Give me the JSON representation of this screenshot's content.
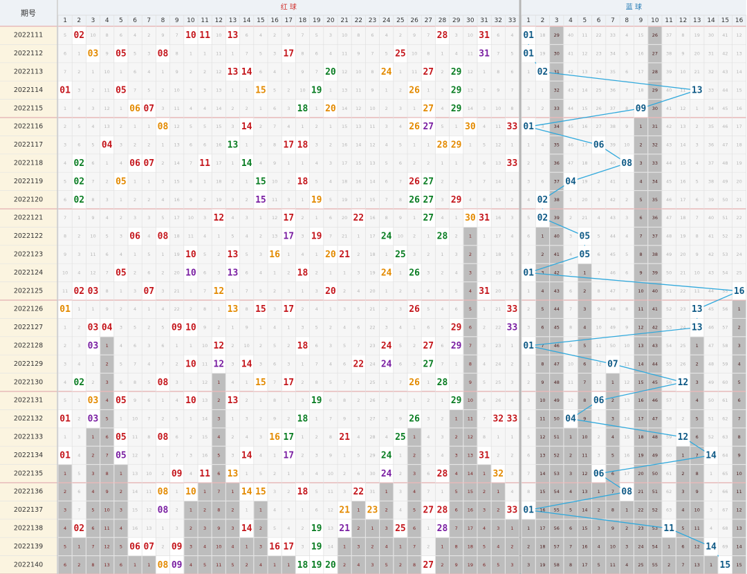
{
  "header": {
    "period_label": "期号",
    "red_section": "红 球",
    "blue_section": "蓝 球",
    "red_numbers": [
      "1",
      "2",
      "3",
      "4",
      "5",
      "6",
      "7",
      "8",
      "9",
      "10",
      "11",
      "12",
      "13",
      "14",
      "15",
      "16",
      "17",
      "18",
      "19",
      "20",
      "21",
      "22",
      "23",
      "24",
      "25",
      "26",
      "27",
      "28",
      "29",
      "30",
      "31",
      "32",
      "33"
    ],
    "blue_numbers": [
      "1",
      "2",
      "3",
      "4",
      "5",
      "6",
      "7",
      "8",
      "9",
      "10",
      "11",
      "12",
      "13",
      "14",
      "15",
      "16"
    ]
  },
  "colors": {
    "red_ball_palette": [
      "#c4161c",
      "#e38a00",
      "#0a7d23",
      "#7a1fa2"
    ],
    "blue_ball": "#0f5a86",
    "trend_line": "#2ea8dc",
    "missing_bar": "#bdbdbd",
    "header_bg": "#eef2f6",
    "period_bg": "#fbf4e0"
  },
  "chart_data": {
    "type": "table",
    "title": "",
    "periods": [
      "2022111",
      "2022112",
      "2022113",
      "2022114",
      "2022115",
      "2022116",
      "2022117",
      "2022118",
      "2022119",
      "2022120",
      "2022121",
      "2022122",
      "2022123",
      "2022124",
      "2022125",
      "2022126",
      "2022127",
      "2022128",
      "2022129",
      "2022130",
      "2022131",
      "2022132",
      "2022133",
      "2022134",
      "2022135",
      "2022136",
      "2022137",
      "2022138",
      "2022139",
      "2022140"
    ],
    "red_balls": [
      [
        2,
        10,
        11,
        13,
        28,
        31
      ],
      [
        3,
        5,
        8,
        17,
        25,
        31
      ],
      [
        13,
        14,
        20,
        24,
        27,
        29
      ],
      [
        1,
        5,
        15,
        19,
        26,
        29
      ],
      [
        6,
        7,
        18,
        20,
        27,
        29
      ],
      [
        8,
        14,
        26,
        27,
        30,
        33
      ],
      [
        4,
        13,
        17,
        18,
        28,
        29
      ],
      [
        2,
        6,
        7,
        11,
        14,
        33
      ],
      [
        2,
        5,
        15,
        18,
        26,
        27
      ],
      [
        2,
        15,
        19,
        26,
        27,
        29
      ],
      [
        12,
        17,
        22,
        27,
        30,
        31
      ],
      [
        6,
        8,
        17,
        19,
        24,
        28
      ],
      [
        10,
        13,
        16,
        20,
        21,
        25
      ],
      [
        5,
        10,
        13,
        18,
        24,
        26
      ],
      [
        2,
        3,
        7,
        12,
        20,
        31
      ],
      [
        1,
        13,
        15,
        17,
        26,
        33
      ],
      [
        3,
        4,
        9,
        10,
        29,
        33
      ],
      [
        3,
        12,
        18,
        24,
        27,
        29
      ],
      [
        10,
        12,
        14,
        22,
        24,
        27
      ],
      [
        2,
        8,
        15,
        17,
        26,
        28
      ],
      [
        3,
        5,
        10,
        13,
        19,
        29
      ],
      [
        1,
        3,
        18,
        26,
        32,
        33
      ],
      [
        5,
        8,
        16,
        17,
        21,
        25
      ],
      [
        1,
        5,
        14,
        17,
        24,
        31
      ],
      [
        9,
        11,
        13,
        24,
        28,
        32
      ],
      [
        8,
        10,
        14,
        15,
        18,
        22
      ],
      [
        8,
        21,
        23,
        27,
        28,
        33
      ],
      [
        2,
        14,
        19,
        21,
        25,
        28
      ],
      [
        6,
        7,
        9,
        16,
        17,
        19
      ],
      [
        8,
        9,
        18,
        19,
        20,
        27
      ]
    ],
    "red_ball_colors": [
      [
        0,
        0,
        0,
        0,
        0,
        0
      ],
      [
        1,
        0,
        0,
        0,
        0,
        3
      ],
      [
        0,
        0,
        2,
        1,
        0,
        2
      ],
      [
        0,
        0,
        1,
        2,
        1,
        2
      ],
      [
        1,
        0,
        2,
        1,
        1,
        2
      ],
      [
        1,
        0,
        1,
        3,
        1,
        0
      ],
      [
        0,
        2,
        0,
        0,
        1,
        1
      ],
      [
        2,
        0,
        0,
        0,
        2,
        0
      ],
      [
        2,
        1,
        2,
        0,
        0,
        2
      ],
      [
        2,
        3,
        1,
        2,
        2,
        0
      ],
      [
        0,
        0,
        0,
        2,
        1,
        0
      ],
      [
        0,
        0,
        3,
        0,
        2,
        2
      ],
      [
        0,
        0,
        1,
        1,
        0,
        2
      ],
      [
        0,
        3,
        3,
        0,
        1,
        2
      ],
      [
        0,
        0,
        0,
        1,
        0,
        0
      ],
      [
        1,
        1,
        0,
        0,
        0,
        0
      ],
      [
        0,
        0,
        0,
        0,
        0,
        3
      ],
      [
        3,
        0,
        0,
        0,
        0,
        3
      ],
      [
        0,
        3,
        0,
        0,
        3,
        2
      ],
      [
        2,
        0,
        1,
        0,
        1,
        2
      ],
      [
        1,
        0,
        0,
        0,
        2,
        2
      ],
      [
        0,
        3,
        2,
        2,
        0,
        0
      ],
      [
        0,
        0,
        1,
        2,
        0,
        2
      ],
      [
        0,
        3,
        0,
        3,
        2,
        0
      ],
      [
        0,
        0,
        1,
        3,
        0,
        1
      ],
      [
        1,
        1,
        1,
        1,
        0,
        0
      ],
      [
        3,
        1,
        1,
        0,
        0,
        0
      ],
      [
        0,
        0,
        2,
        3,
        0,
        3
      ],
      [
        0,
        0,
        0,
        0,
        0,
        2
      ],
      [
        1,
        3,
        2,
        2,
        2,
        0
      ]
    ],
    "blue_balls": [
      1,
      1,
      2,
      13,
      9,
      1,
      6,
      8,
      4,
      2,
      2,
      5,
      5,
      1,
      16,
      13,
      13,
      1,
      7,
      12,
      6,
      4,
      12,
      14,
      6,
      8,
      1,
      11,
      14,
      15
    ],
    "missing_shading": "gray cells mark consecutive periods a number has not been drawn",
    "trend_line": "blue ball numbers connected period to period"
  }
}
